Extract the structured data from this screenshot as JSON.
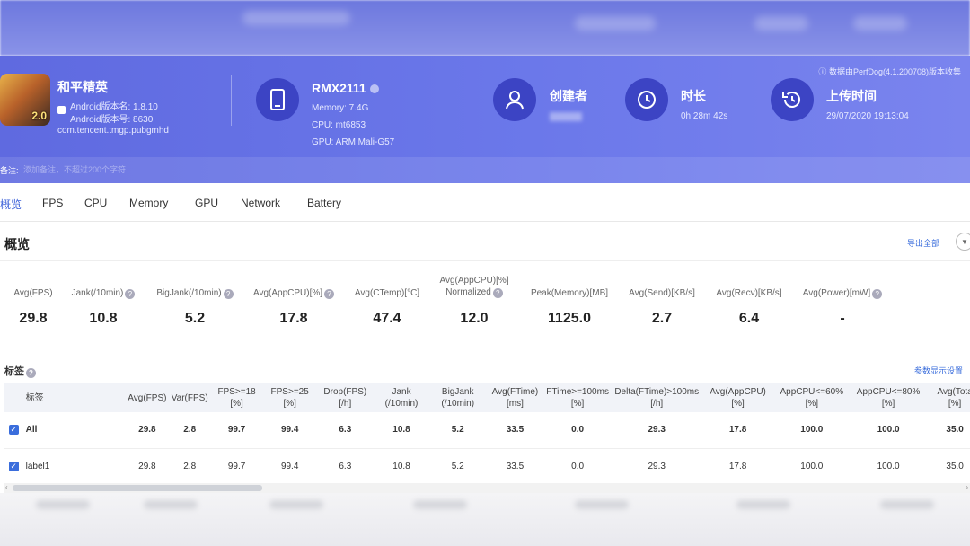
{
  "app": {
    "name": "和平精英",
    "version_name_line": "Android版本名: 1.8.10",
    "version_code_line": "Android版本号: 8630",
    "package": "com.tencent.tmgp.pubgmhd",
    "icon_badge": "2.0"
  },
  "device": {
    "model": "RMX2111",
    "memory": "Memory: 7.4G",
    "cpu": "CPU: mt6853",
    "gpu": "GPU: ARM Mali-G57"
  },
  "creator": {
    "label": "创建者"
  },
  "duration": {
    "label": "时长",
    "value": "0h 28m 42s"
  },
  "upload": {
    "label": "上传时间",
    "value": "29/07/2020 19:13:04"
  },
  "source_note": "数据由PerfDog(4.1.200708)版本收集",
  "remark": {
    "label": "备注:",
    "placeholder": "添加备注，不超过200个字符"
  },
  "tabs": [
    "概览",
    "FPS",
    "CPU",
    "Memory",
    "GPU",
    "Network",
    "Battery"
  ],
  "overview": {
    "title": "概览",
    "export_label": "导出全部"
  },
  "metrics": [
    {
      "label": "Avg(FPS)",
      "label2": "",
      "help": false,
      "value": "29.8"
    },
    {
      "label": "Jank(/10min)",
      "label2": "",
      "help": true,
      "value": "10.8"
    },
    {
      "label": "BigJank(/10min)",
      "label2": "",
      "help": true,
      "value": "5.2"
    },
    {
      "label": "Avg(AppCPU)[%]",
      "label2": "",
      "help": true,
      "value": "17.8"
    },
    {
      "label": "Avg(CTemp)[°C]",
      "label2": "",
      "help": false,
      "value": "47.4"
    },
    {
      "label": "Avg(AppCPU)[%]",
      "label2": "Normalized",
      "help": true,
      "value": "12.0"
    },
    {
      "label": "Peak(Memory)[MB]",
      "label2": "",
      "help": false,
      "value": "1125.0"
    },
    {
      "label": "Avg(Send)[KB/s]",
      "label2": "",
      "help": false,
      "value": "2.7"
    },
    {
      "label": "Avg(Recv)[KB/s]",
      "label2": "",
      "help": false,
      "value": "6.4"
    },
    {
      "label": "Avg(Power)[mW]",
      "label2": "",
      "help": true,
      "value": "-"
    }
  ],
  "tags": {
    "title": "标签",
    "param_label": "参数显示设置"
  },
  "table": {
    "headers": [
      [
        "标签",
        ""
      ],
      [
        "Avg(FPS)",
        ""
      ],
      [
        "Var(FPS)",
        ""
      ],
      [
        "FPS>=18",
        "[%]"
      ],
      [
        "FPS>=25",
        "[%]"
      ],
      [
        "Drop(FPS)",
        "[/h]"
      ],
      [
        "Jank",
        "(/10min)"
      ],
      [
        "BigJank",
        "(/10min)"
      ],
      [
        "Avg(FTime)",
        "[ms]"
      ],
      [
        "FTime>=100ms",
        "[%]"
      ],
      [
        "Delta(FTime)>100ms",
        "[/h]"
      ],
      [
        "Avg(AppCPU)",
        "[%]"
      ],
      [
        "AppCPU<=60%",
        "[%]"
      ],
      [
        "AppCPU<=80%",
        "[%]"
      ],
      [
        "Avg(Tota",
        "[%]"
      ]
    ],
    "rows": [
      {
        "checked": true,
        "cells": [
          "All",
          "29.8",
          "2.8",
          "99.7",
          "99.4",
          "6.3",
          "10.8",
          "5.2",
          "33.5",
          "0.0",
          "29.3",
          "17.8",
          "100.0",
          "100.0",
          "35.0"
        ]
      },
      {
        "checked": true,
        "cells": [
          "label1",
          "29.8",
          "2.8",
          "99.7",
          "99.4",
          "6.3",
          "10.8",
          "5.2",
          "33.5",
          "0.0",
          "29.3",
          "17.8",
          "100.0",
          "100.0",
          "35.0"
        ]
      }
    ]
  },
  "colors": {
    "header_bg": "#6470e4",
    "accent": "#3a6ddc",
    "icon_circle": "#3c44c4"
  }
}
